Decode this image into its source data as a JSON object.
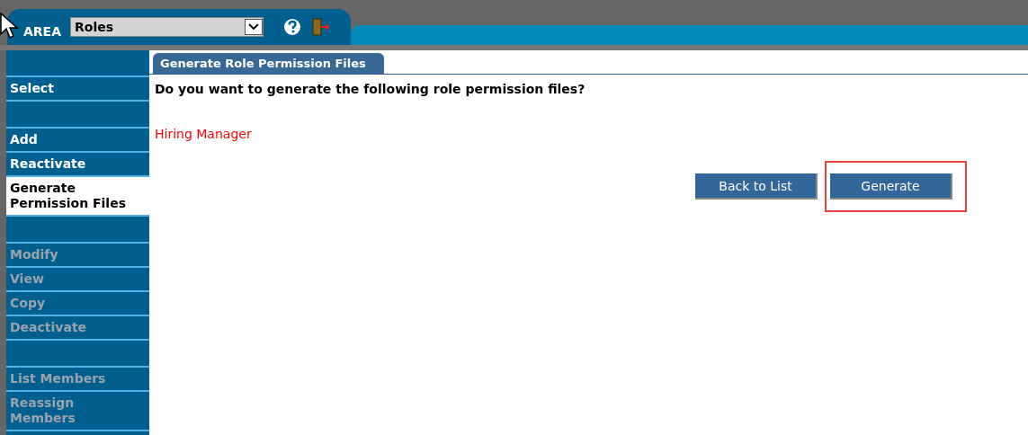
{
  "header": {
    "area_label": "AREA",
    "area_select": {
      "value": "Roles"
    }
  },
  "sidebar": {
    "groups": [
      [
        {
          "label": "Select",
          "selected": false,
          "disabled": false
        }
      ],
      [
        {
          "label": "Add",
          "selected": false,
          "disabled": false
        },
        {
          "label": "Reactivate",
          "selected": false,
          "disabled": false
        },
        {
          "label": "Generate Permission Files",
          "selected": true,
          "disabled": false
        }
      ],
      [
        {
          "label": "Modify",
          "selected": false,
          "disabled": true
        },
        {
          "label": "View",
          "selected": false,
          "disabled": true
        },
        {
          "label": "Copy",
          "selected": false,
          "disabled": true
        },
        {
          "label": "Deactivate",
          "selected": false,
          "disabled": true
        }
      ],
      [
        {
          "label": "List Members",
          "selected": false,
          "disabled": true
        },
        {
          "label": "Reassign Members",
          "selected": false,
          "disabled": true
        }
      ]
    ]
  },
  "content": {
    "tab": "Generate Role Permission Files",
    "question": "Do you want to generate the following role permission files?",
    "roles": [
      "Hiring Manager"
    ],
    "buttons": [
      {
        "label": "Back to List",
        "highlighted": false
      },
      {
        "label": "Generate",
        "highlighted": true
      }
    ]
  }
}
